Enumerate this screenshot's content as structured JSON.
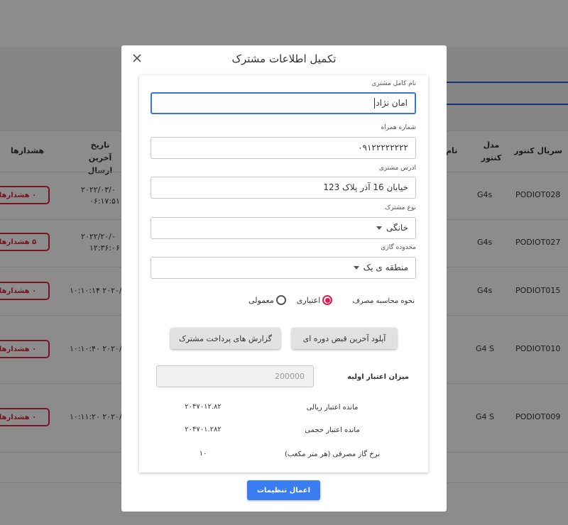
{
  "background": {
    "columns": {
      "serial": "سریال کنتور",
      "model": "مدل کنتور",
      "name_partial": "نام",
      "last_send": "تاریخ آخرین ارسال",
      "alerts": "هشدارها"
    },
    "rows": [
      {
        "serial": "PODIOT028",
        "model": "G4s",
        "date_line1": "۲۰۲۲/۰۳/۰",
        "date_line2": "۰۶:۱۷:۵۱",
        "alert": "۰ هشدارها"
      },
      {
        "serial": "PODIOT027",
        "model": "G4s",
        "date_line1": "۲۰۲۲/۲۰/۰",
        "date_line2": "۱۲:۳۶:۰۶",
        "alert": "۵ هشدارها"
      },
      {
        "serial": "PODIOT015",
        "model": "G4s",
        "date_line1": "۱۰:۱۰:۱۴ ۲۰۲۰/۰",
        "date_line2": "",
        "alert": "۰ هشدارها"
      },
      {
        "serial": "PODIOT010",
        "model": "G4 S",
        "date_line1": "۱۰:۱۰:۴۰ ۲۰۲۰/۰",
        "date_line2": "",
        "alert": "۰ هشدارها"
      },
      {
        "serial": "PODIOT009",
        "model": "G4 S",
        "date_line1": "۱۰:۱۱:۲۰ ۲۰۲۰/۰",
        "date_line2": "",
        "alert": "۰ هشدارها"
      }
    ]
  },
  "modal": {
    "title": "تکمیل اطلاعات مشترک",
    "fields": {
      "full_name": {
        "label": "نام کامل مشتری",
        "value": "امان نژاد"
      },
      "phone": {
        "label": "شماره همراه",
        "value": "۰۹۱۲۲۲۲۲۲۲۲"
      },
      "address": {
        "label": "ادرس مشتری",
        "value": "خیابان 16 آذر پلاک 123"
      },
      "subscriber_type": {
        "label": "نوع مشترک",
        "value": "خانگی"
      },
      "gas_zone": {
        "label": "محدوده گازی",
        "value": "منطقه ی یک"
      }
    },
    "calc_method": {
      "label": "نحوه محاسبه مصرف",
      "option_credit": "اعتباری",
      "option_normal": "معمولی",
      "selected": "اعتباری"
    },
    "buttons": {
      "upload_bill": "آپلود آخرین قبض دوره ای",
      "payment_report": "گزارش های پرداخت مشترک",
      "apply": "اعمال تنظیمات"
    },
    "initial_credit": {
      "label": "میزان اعتبار اولیه",
      "placeholder": "200000"
    },
    "info": [
      {
        "label": "مانده اعتبار ریالی",
        "value": "۲۰۴۷۰۱۲.۸۲"
      },
      {
        "label": "مانده اعتبار حجمی",
        "value": "۲۰۴۷۰۱.۲۸۲"
      },
      {
        "label": "نرخ گاز مصرفی (هر متر مکعب)",
        "value": "۱۰"
      }
    ],
    "colors": {
      "accent": "#3a7df0",
      "radio": "#d6204b",
      "alert": "#d9253f"
    }
  }
}
